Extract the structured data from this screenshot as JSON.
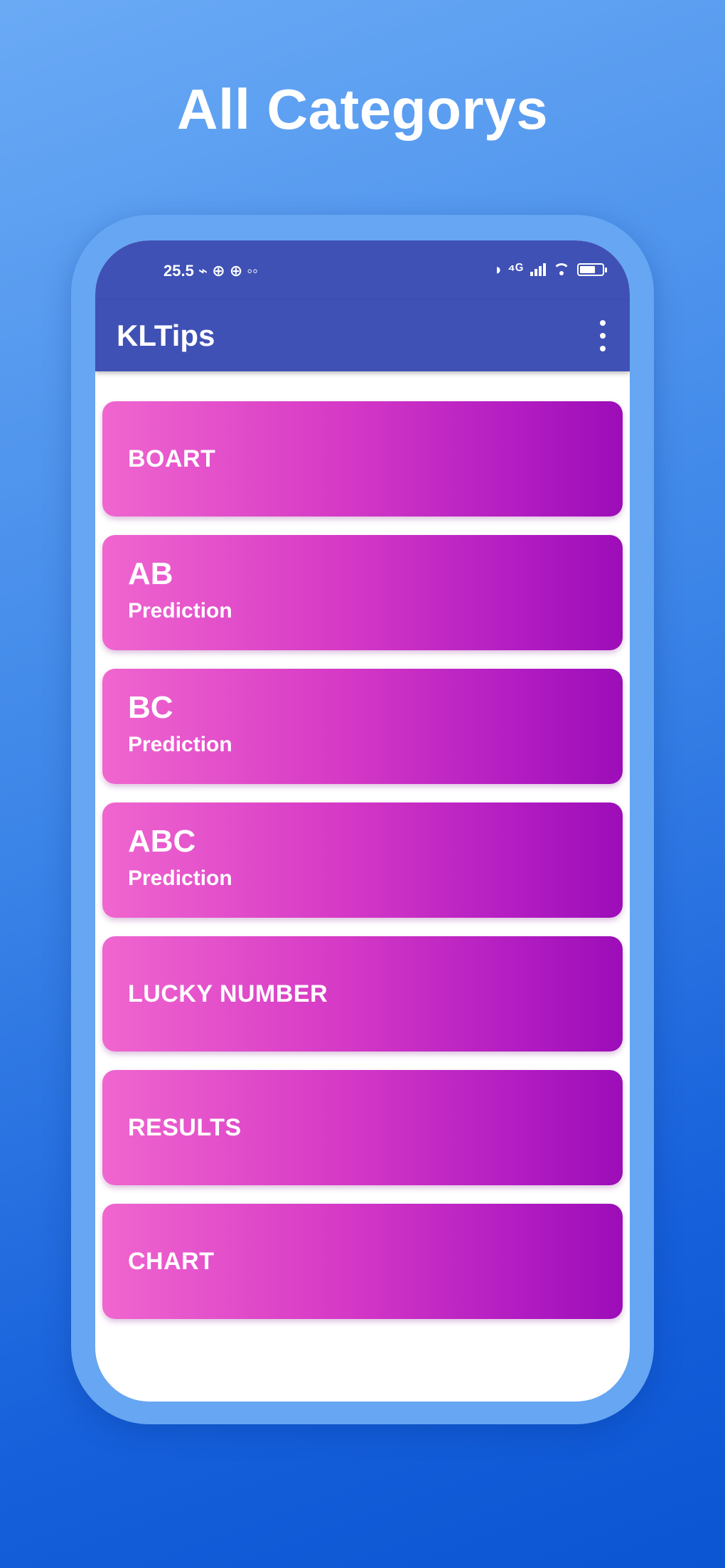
{
  "page": {
    "headline": "All Categorys"
  },
  "status_bar": {
    "left_text": "25.5 ⌁ ⊕ ⊕ ◦◦",
    "right_text": "◗ ⁴ᴳ",
    "battery_level": 0.7
  },
  "app_bar": {
    "title": "KLTips",
    "menu_icon": "more-vert-icon"
  },
  "categories": [
    {
      "title": "BOART",
      "subtitle": ""
    },
    {
      "title": "AB",
      "subtitle": "Prediction"
    },
    {
      "title": "BC",
      "subtitle": "Prediction"
    },
    {
      "title": "ABC",
      "subtitle": "Prediction"
    },
    {
      "title": "LUCKY NUMBER",
      "subtitle": ""
    },
    {
      "title": "RESULTS",
      "subtitle": ""
    },
    {
      "title": "CHART",
      "subtitle": ""
    }
  ],
  "colors": {
    "app_bar": "#3f51b5",
    "card_gradient_start": "#f066cf",
    "card_gradient_end": "#9c0db8",
    "frame": "#66a6f2"
  }
}
